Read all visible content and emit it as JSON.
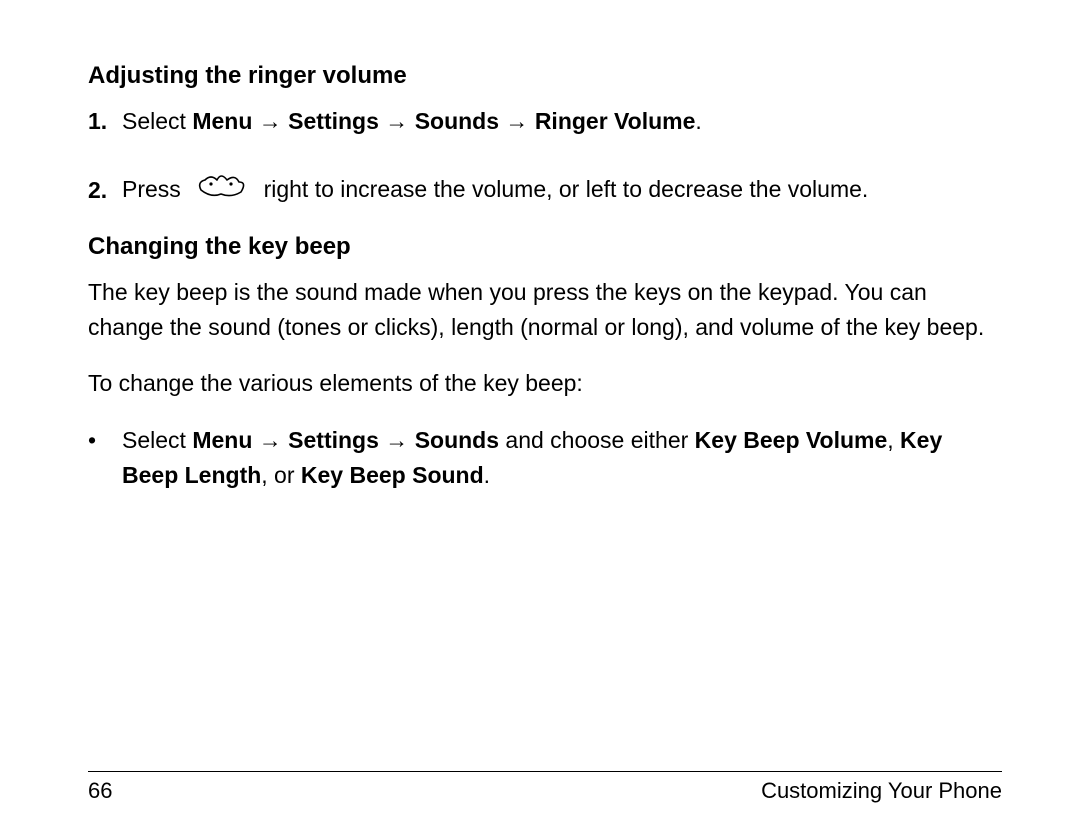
{
  "section1": {
    "heading": "Adjusting the ringer volume",
    "step1": {
      "num": "1.",
      "prefix": "Select ",
      "menu": "Menu",
      "settings": "Settings",
      "sounds": "Sounds",
      "ringer": "Ringer Volume",
      "period": "."
    },
    "step2": {
      "num": "2.",
      "before": "Press ",
      "after": " right to increase the volume, or left to decrease the volume."
    }
  },
  "section2": {
    "heading": "Changing the key beep",
    "para1": "The key beep is the sound made when you press the keys on the keypad. You can change the sound (tones or clicks), length (normal or long), and volume of the key beep.",
    "para2": "To change the various elements of the key beep:",
    "bullet": {
      "dot": "•",
      "prefix": "Select ",
      "menu": "Menu",
      "settings": "Settings",
      "sounds": "Sounds",
      "mid": " and choose either ",
      "kbv": "Key Beep Volume",
      "comma": ", ",
      "kbl": "Key Beep Length",
      "or": ", or ",
      "kbs": "Key Beep Sound",
      "period": "."
    }
  },
  "arrow": "→",
  "footer": {
    "page": "66",
    "title": "Customizing Your Phone"
  }
}
